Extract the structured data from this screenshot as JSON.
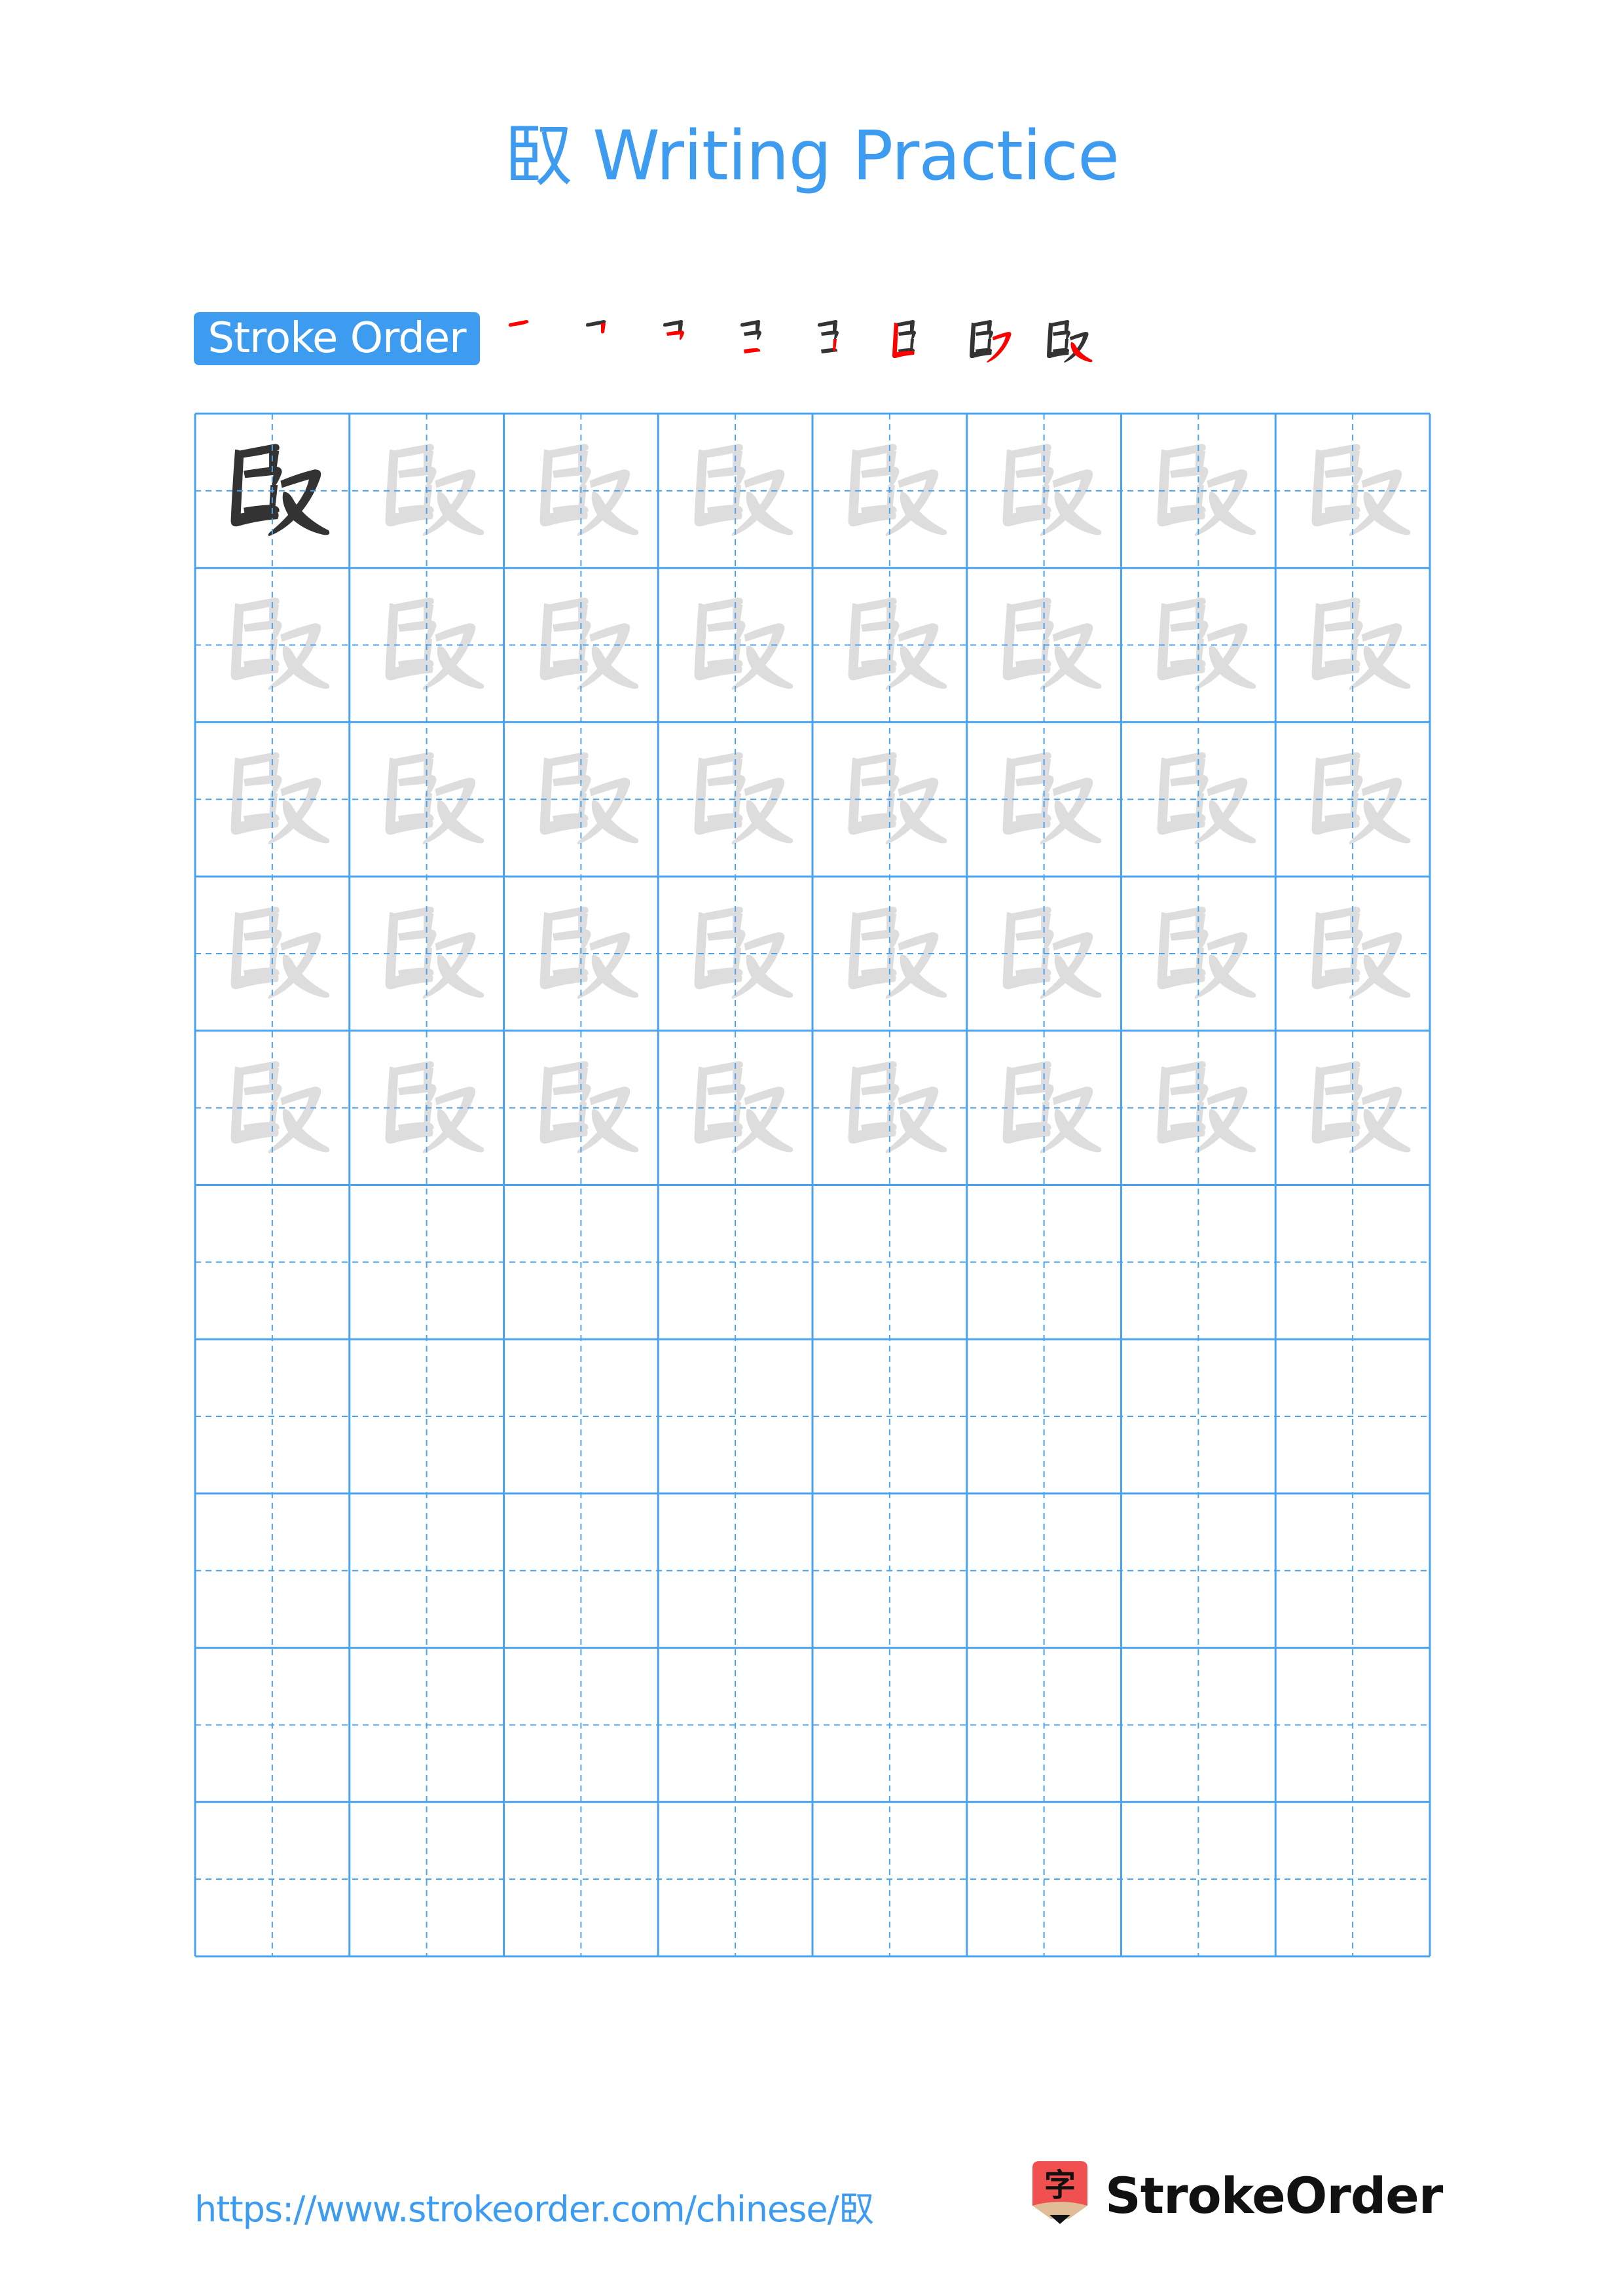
{
  "page": {
    "character": "臤",
    "title": "臤 Writing Practice",
    "stroke_order_label": "Stroke Order",
    "stroke_count": 8,
    "footer_url": "https://www.strokeorder.com/chinese/臤",
    "brand_name": "StrokeOrder",
    "brand_logo_glyph": "字"
  },
  "grid": {
    "columns": 8,
    "rows": 10,
    "model_cells": 1,
    "trace_rows": 5,
    "blank_rows": 5
  },
  "colors": {
    "accent": "#3d9cf0",
    "grid_line": "#4aa3f0",
    "model_char": "#333333",
    "trace_char": "#dddddd",
    "current_stroke": "#ff0000",
    "logo_red": "#f05050",
    "logo_tan": "#e0bd96"
  }
}
